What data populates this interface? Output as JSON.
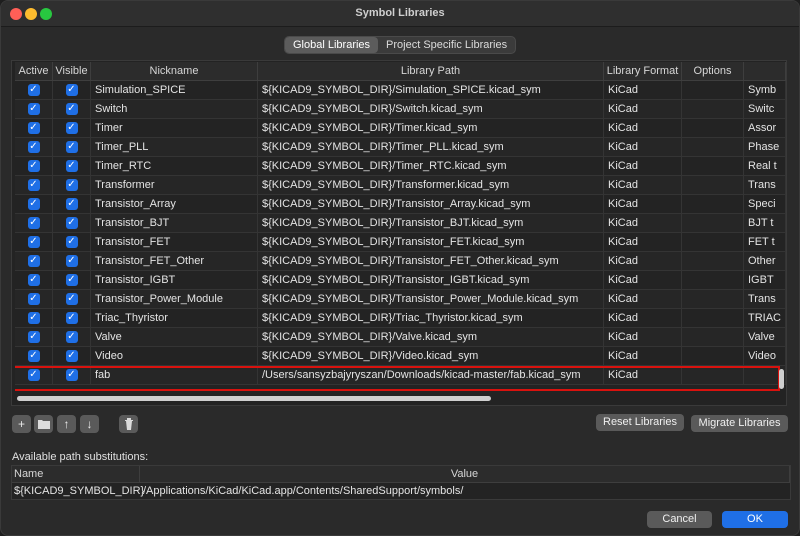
{
  "window": {
    "title": "Symbol Libraries"
  },
  "tabs": [
    "Global Libraries",
    "Project Specific Libraries"
  ],
  "table": {
    "headers": [
      "Active",
      "Visible",
      "Nickname",
      "Library Path",
      "Library Format",
      "Options",
      ""
    ],
    "rows": [
      {
        "nickname": "Simulation_SPICE",
        "path": "${KICAD9_SYMBOL_DIR}/Simulation_SPICE.kicad_sym",
        "format": "KiCad",
        "options": "",
        "desc": "Symb"
      },
      {
        "nickname": "Switch",
        "path": "${KICAD9_SYMBOL_DIR}/Switch.kicad_sym",
        "format": "KiCad",
        "options": "",
        "desc": "Switc"
      },
      {
        "nickname": "Timer",
        "path": "${KICAD9_SYMBOL_DIR}/Timer.kicad_sym",
        "format": "KiCad",
        "options": "",
        "desc": "Assor"
      },
      {
        "nickname": "Timer_PLL",
        "path": "${KICAD9_SYMBOL_DIR}/Timer_PLL.kicad_sym",
        "format": "KiCad",
        "options": "",
        "desc": "Phase"
      },
      {
        "nickname": "Timer_RTC",
        "path": "${KICAD9_SYMBOL_DIR}/Timer_RTC.kicad_sym",
        "format": "KiCad",
        "options": "",
        "desc": "Real t"
      },
      {
        "nickname": "Transformer",
        "path": "${KICAD9_SYMBOL_DIR}/Transformer.kicad_sym",
        "format": "KiCad",
        "options": "",
        "desc": "Trans"
      },
      {
        "nickname": "Transistor_Array",
        "path": "${KICAD9_SYMBOL_DIR}/Transistor_Array.kicad_sym",
        "format": "KiCad",
        "options": "",
        "desc": "Speci"
      },
      {
        "nickname": "Transistor_BJT",
        "path": "${KICAD9_SYMBOL_DIR}/Transistor_BJT.kicad_sym",
        "format": "KiCad",
        "options": "",
        "desc": "BJT t"
      },
      {
        "nickname": "Transistor_FET",
        "path": "${KICAD9_SYMBOL_DIR}/Transistor_FET.kicad_sym",
        "format": "KiCad",
        "options": "",
        "desc": "FET t"
      },
      {
        "nickname": "Transistor_FET_Other",
        "path": "${KICAD9_SYMBOL_DIR}/Transistor_FET_Other.kicad_sym",
        "format": "KiCad",
        "options": "",
        "desc": "Other"
      },
      {
        "nickname": "Transistor_IGBT",
        "path": "${KICAD9_SYMBOL_DIR}/Transistor_IGBT.kicad_sym",
        "format": "KiCad",
        "options": "",
        "desc": "IGBT"
      },
      {
        "nickname": "Transistor_Power_Module",
        "path": "${KICAD9_SYMBOL_DIR}/Transistor_Power_Module.kicad_sym",
        "format": "KiCad",
        "options": "",
        "desc": "Trans"
      },
      {
        "nickname": "Triac_Thyristor",
        "path": "${KICAD9_SYMBOL_DIR}/Triac_Thyristor.kicad_sym",
        "format": "KiCad",
        "options": "",
        "desc": "TRIAC"
      },
      {
        "nickname": "Valve",
        "path": "${KICAD9_SYMBOL_DIR}/Valve.kicad_sym",
        "format": "KiCad",
        "options": "",
        "desc": "Valve"
      },
      {
        "nickname": "Video",
        "path": "${KICAD9_SYMBOL_DIR}/Video.kicad_sym",
        "format": "KiCad",
        "options": "",
        "desc": "Video"
      },
      {
        "nickname": "fab",
        "path": "/Users/sansyzbajyryszan/Downloads/kicad-master/fab.kicad_sym",
        "format": "KiCad",
        "options": "",
        "desc": ""
      }
    ]
  },
  "checkbox_glyph": "✓",
  "toolbar": {
    "icons": [
      "plus-icon",
      "folder-icon",
      "arrow-up-icon",
      "arrow-down-icon",
      "trash-icon"
    ],
    "reset_label": "Reset Libraries",
    "migrate_label": "Migrate Libraries"
  },
  "substitutions": {
    "label": "Available path substitutions:",
    "headers": [
      "Name",
      "Value"
    ],
    "rows": [
      {
        "name": "${KICAD9_SYMBOL_DIR}",
        "value": "/Applications/KiCad/KiCad.app/Contents/SharedSupport/symbols/"
      }
    ]
  },
  "footer": {
    "cancel_label": "Cancel",
    "ok_label": "OK"
  },
  "colors": {
    "accent": "#1f6fe6",
    "highlight_border": "#d9120e"
  }
}
